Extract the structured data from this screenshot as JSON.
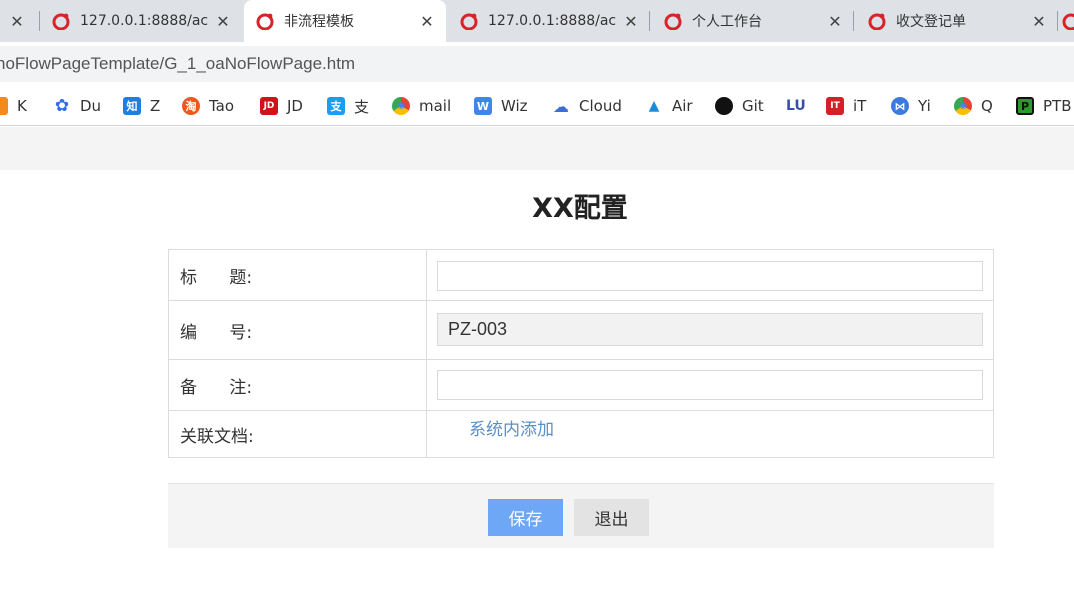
{
  "browser": {
    "tabs": [
      {
        "title": "",
        "close": "✕"
      },
      {
        "title": "127.0.0.1:8888/ac",
        "close": "✕"
      },
      {
        "title": "非流程模板",
        "close": "✕"
      },
      {
        "title": "127.0.0.1:8888/ac",
        "close": "✕"
      },
      {
        "title": "个人工作台",
        "close": "✕"
      },
      {
        "title": "收文登记单",
        "close": "✕"
      }
    ],
    "address": "noFlowPageTemplate/G_1_oaNoFlowPage.htm",
    "bookmarks": [
      {
        "label": "K",
        "icon": "k-icon",
        "color": "#f28a1e",
        "glyph": ""
      },
      {
        "label": "Du",
        "icon": "baidu-paw-icon",
        "color": "#2f6ee8",
        "glyph": "✿"
      },
      {
        "label": "Z",
        "icon": "zhihu-icon",
        "color": "#1f7fe0",
        "glyph": "知"
      },
      {
        "label": "Tao",
        "icon": "taobao-icon",
        "color": "#f0571f",
        "glyph": "淘"
      },
      {
        "label": "JD",
        "icon": "jd-icon",
        "color": "#d0121b",
        "glyph": "JD"
      },
      {
        "label": "支",
        "icon": "alipay-icon",
        "color": "#1a9ff0",
        "glyph": "支"
      },
      {
        "label": "mail",
        "icon": "chrome-mail-icon",
        "color": "#2aa34a",
        "glyph": "◉"
      },
      {
        "label": "Wiz",
        "icon": "wiz-icon",
        "color": "#3e86e8",
        "glyph": "W"
      },
      {
        "label": "Cloud",
        "icon": "cloud-icon",
        "color": "#3b6fd6",
        "glyph": "☁"
      },
      {
        "label": "Air",
        "icon": "air-icon",
        "color": "#1b8cd8",
        "glyph": "▲"
      },
      {
        "label": "Git",
        "icon": "github-icon",
        "color": "#111111",
        "glyph": "●"
      },
      {
        "label": "LU",
        "icon": "lu-icon",
        "color": "#3a4fa8",
        "glyph": ""
      },
      {
        "label": "iT",
        "icon": "ithome-icon",
        "color": "#d61f26",
        "glyph": "IT"
      },
      {
        "label": "Yi",
        "icon": "yi-icon",
        "color": "#3b7be0",
        "glyph": "⋈"
      },
      {
        "label": "Q",
        "icon": "chrome-q-icon",
        "color": "#e8b21b",
        "glyph": "◉"
      },
      {
        "label": "PTB",
        "icon": "ptb-icon",
        "color": "#2a9a2a",
        "glyph": "P"
      }
    ]
  },
  "page": {
    "title": "XX配置",
    "fields": [
      {
        "label": "标      题:",
        "value": "",
        "placeholder": ""
      },
      {
        "label": "编      号:",
        "value": "PZ-003"
      },
      {
        "label": "备      注:",
        "value": "",
        "placeholder": ""
      },
      {
        "label": "关联文档:",
        "link": "系统内添加"
      }
    ],
    "buttons": {
      "save": "保存",
      "exit": "退出"
    }
  }
}
